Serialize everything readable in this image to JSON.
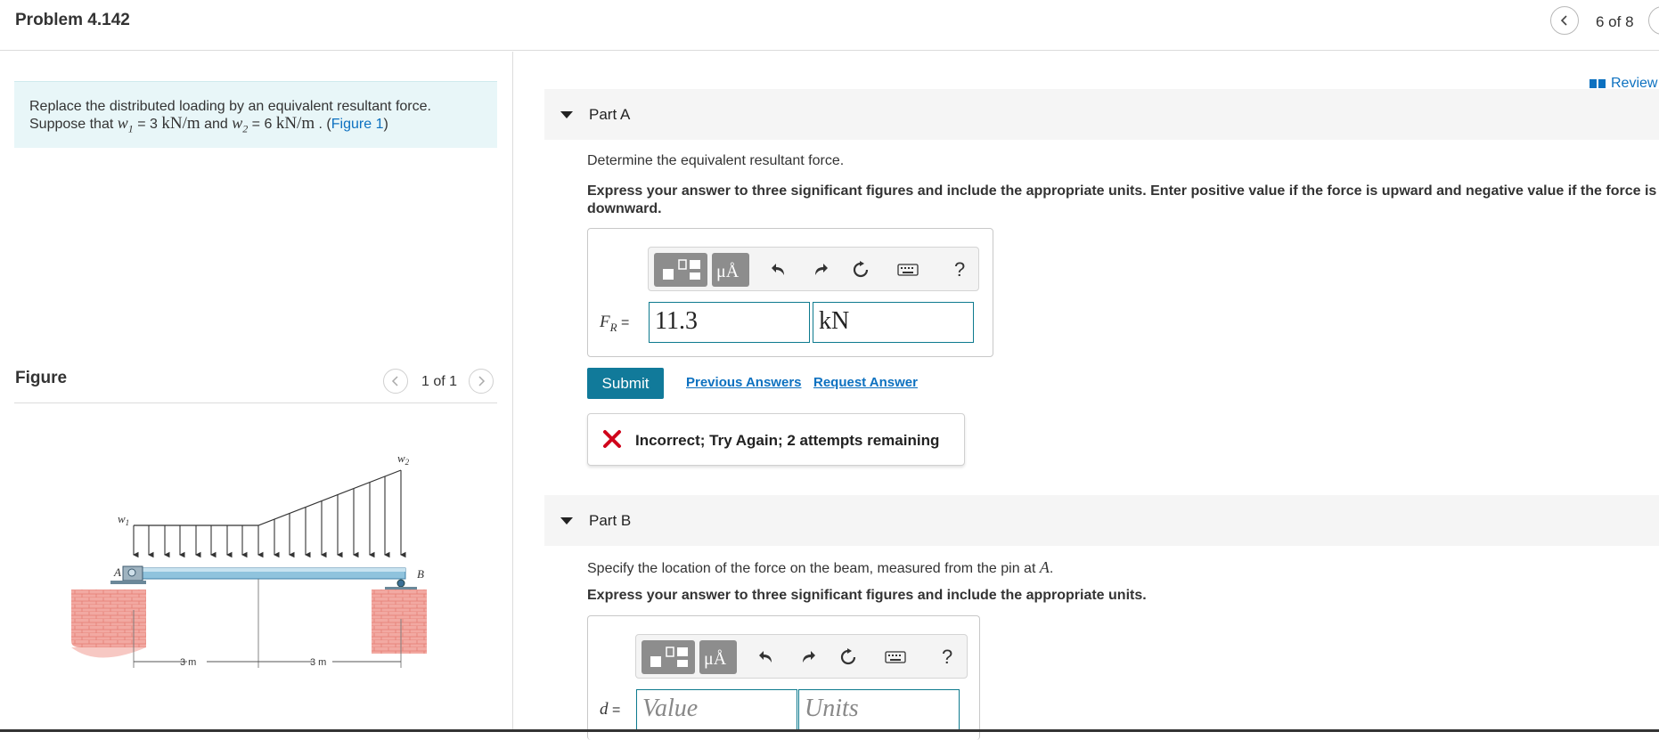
{
  "header": {
    "title": "Problem 4.142",
    "page_count": "6 of 8"
  },
  "problem": {
    "text_line1": "Replace the distributed loading by an equivalent resultant force.",
    "suppose": "Suppose that",
    "w1_symbol": "w",
    "w1_sub": "1",
    "w1_eq": " = 3 ",
    "w1_unit": "kN/m",
    "and": " and ",
    "w2_symbol": "w",
    "w2_sub": "2",
    "w2_eq": " = 6 ",
    "w2_unit": "kN/m",
    "period": " . (",
    "figure_link": "Figure 1",
    "close": ")"
  },
  "figure": {
    "label": "Figure",
    "count": "1 of 1",
    "labels": {
      "w1": "w",
      "w1_sub": "1",
      "w2": "w",
      "w2_sub": "2",
      "a": "A",
      "b": "B",
      "dim1": "3 m",
      "dim2": "3 m"
    }
  },
  "review": "Review",
  "part_a": {
    "title": "Part A",
    "prompt": "Determine the equivalent resultant force.",
    "instruction": "Express your answer to three significant figures and include the appropriate units. Enter positive value if the force is upward and negative value if the force is downward.",
    "var_main": "F",
    "var_sub": "R",
    "var_eq": " =",
    "value": "11.3",
    "units": "kN",
    "help": "?",
    "submit": "Submit",
    "previous_answers": "Previous Answers",
    "request_answer": "Request Answer",
    "feedback": "Incorrect; Try Again; 2 attempts remaining",
    "mu_label": "μÅ"
  },
  "part_b": {
    "title": "Part B",
    "prompt_pre": "Specify the location of the force on the beam, measured from the pin at ",
    "prompt_var": "A",
    "prompt_post": ".",
    "instruction": "Express your answer to three significant figures and include the appropriate units.",
    "var_main": "d",
    "var_eq": " =",
    "value_placeholder": "Value",
    "units_placeholder": "Units",
    "help": "?",
    "mu_label": "μÅ"
  },
  "colors": {
    "accent": "#117a9a",
    "link": "#0d71c0",
    "problem_bg": "#e8f6f8",
    "error": "#d0021b"
  }
}
